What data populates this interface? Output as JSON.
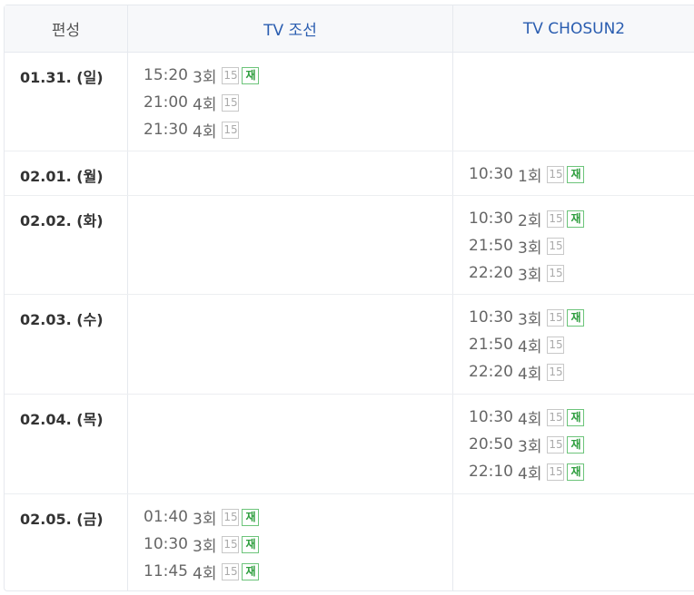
{
  "header": {
    "date_col": "편성",
    "channel1": "TV 조선",
    "channel2": "TV CHOSUN2"
  },
  "badge_colors": {
    "age": "#aaaaaa",
    "rerun": "#2e9e3e",
    "channel": "#2a5db0"
  },
  "rows": [
    {
      "date": "01.31. (일)",
      "ch1": [
        {
          "time": "15:20",
          "ep": "3회",
          "age": "15",
          "rerun": "재"
        },
        {
          "time": "21:00",
          "ep": "4회",
          "age": "15",
          "rerun": null
        },
        {
          "time": "21:30",
          "ep": "4회",
          "age": "15",
          "rerun": null
        }
      ],
      "ch2": []
    },
    {
      "date": "02.01. (월)",
      "ch1": [],
      "ch2": [
        {
          "time": "10:30",
          "ep": "1회",
          "age": "15",
          "rerun": "재"
        }
      ]
    },
    {
      "date": "02.02. (화)",
      "ch1": [],
      "ch2": [
        {
          "time": "10:30",
          "ep": "2회",
          "age": "15",
          "rerun": "재"
        },
        {
          "time": "21:50",
          "ep": "3회",
          "age": "15",
          "rerun": null
        },
        {
          "time": "22:20",
          "ep": "3회",
          "age": "15",
          "rerun": null
        }
      ]
    },
    {
      "date": "02.03. (수)",
      "ch1": [],
      "ch2": [
        {
          "time": "10:30",
          "ep": "3회",
          "age": "15",
          "rerun": "재"
        },
        {
          "time": "21:50",
          "ep": "4회",
          "age": "15",
          "rerun": null
        },
        {
          "time": "22:20",
          "ep": "4회",
          "age": "15",
          "rerun": null
        }
      ]
    },
    {
      "date": "02.04. (목)",
      "ch1": [],
      "ch2": [
        {
          "time": "10:30",
          "ep": "4회",
          "age": "15",
          "rerun": "재"
        },
        {
          "time": "20:50",
          "ep": "3회",
          "age": "15",
          "rerun": "재"
        },
        {
          "time": "22:10",
          "ep": "4회",
          "age": "15",
          "rerun": "재"
        }
      ]
    },
    {
      "date": "02.05. (금)",
      "ch1": [
        {
          "time": "01:40",
          "ep": "3회",
          "age": "15",
          "rerun": "재"
        },
        {
          "time": "10:30",
          "ep": "3회",
          "age": "15",
          "rerun": "재"
        },
        {
          "time": "11:45",
          "ep": "4회",
          "age": "15",
          "rerun": "재"
        }
      ],
      "ch2": []
    }
  ]
}
